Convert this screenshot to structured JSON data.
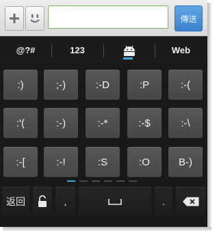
{
  "compose": {
    "add_label": "+",
    "emoji_label": "☺",
    "message_value": "",
    "send_label": "傳送"
  },
  "tabs": [
    {
      "label": "@?#"
    },
    {
      "label": "123"
    },
    {
      "label": "android-icon",
      "icon": "android-icon",
      "selected": true
    },
    {
      "label": "Web"
    }
  ],
  "emoticons": [
    [
      ":)",
      ";-)",
      ":-D",
      ":P",
      ":-("
    ],
    [
      ":'(",
      ":-)",
      ":-*",
      ":-$",
      ":-\\"
    ],
    [
      ":-[",
      ":-!",
      ":S",
      ":O",
      "B-)"
    ]
  ],
  "pager": {
    "pages": 6,
    "current": 1
  },
  "bottom_row": {
    "back_label": "返回",
    "shift_icon": "lock-icon",
    "comma_label": ",",
    "space_icon": "space-bar-icon",
    "period_label": ".",
    "delete_icon": "backspace-icon"
  },
  "colors": {
    "accent_blue": "#3fa9e0",
    "send_button": "#4a90d9",
    "input_border_green": "#7bb661",
    "keyboard_bg": "#191919",
    "key_bg": "#4f4f4f"
  }
}
